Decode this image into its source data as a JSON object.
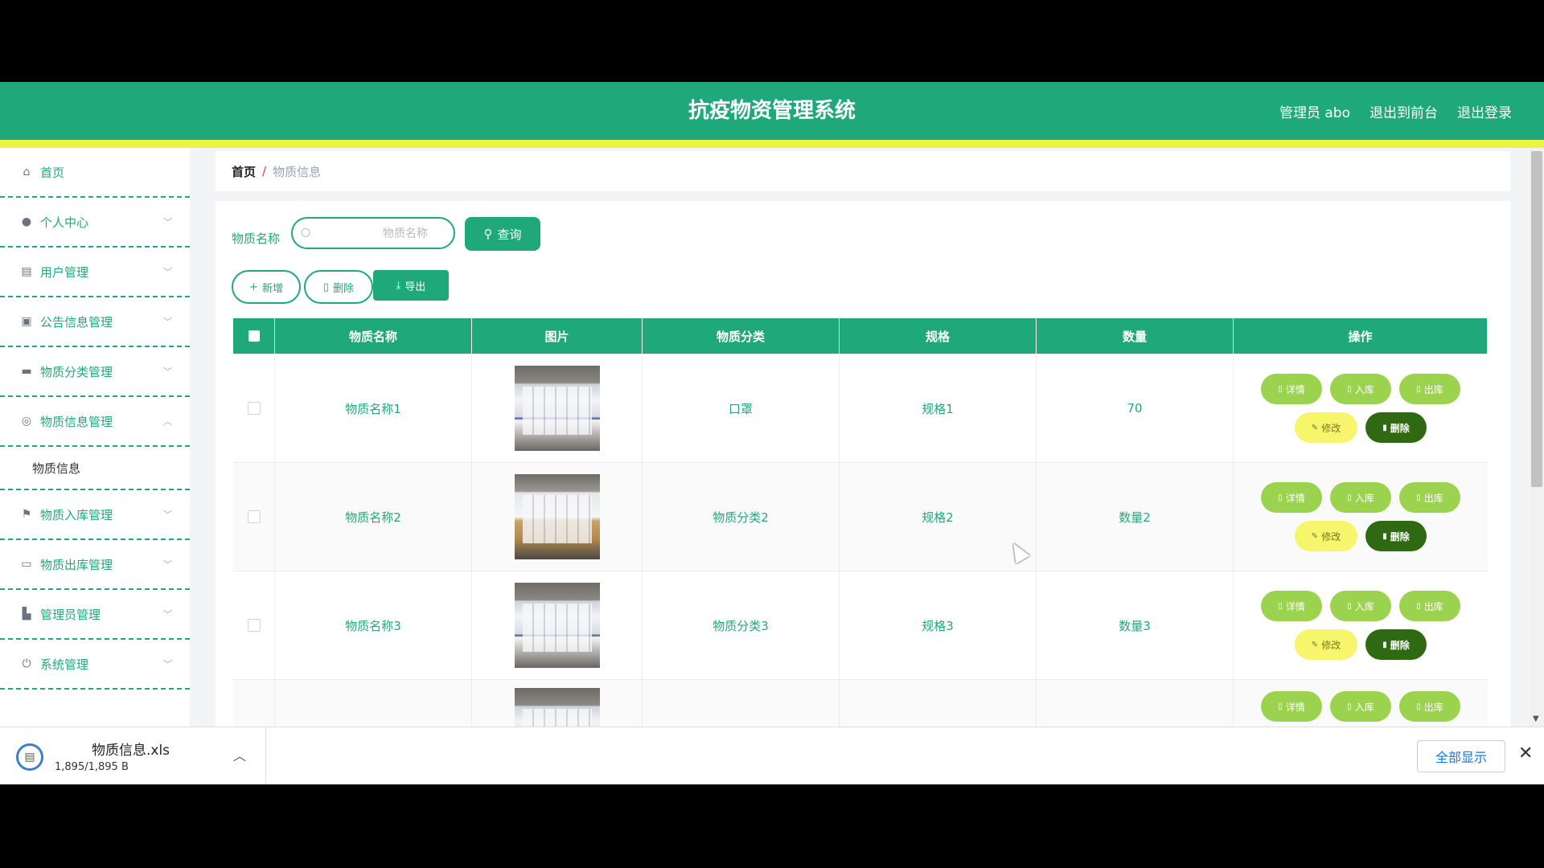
{
  "header": {
    "title": "抗疫物资管理系统",
    "admin_label": "管理员 abo",
    "back_front": "退出到前台",
    "logout": "退出登录"
  },
  "sidebar": {
    "items": [
      {
        "label": "首页",
        "icon": "home-icon"
      },
      {
        "label": "个人中心",
        "icon": "user-icon"
      },
      {
        "label": "用户管理",
        "icon": "chart-icon"
      },
      {
        "label": "公告信息管理",
        "icon": "clipboard-icon"
      },
      {
        "label": "物质分类管理",
        "icon": "briefcase-icon"
      },
      {
        "label": "物质信息管理",
        "icon": "globe-icon"
      },
      {
        "label": "物质入库管理",
        "icon": "flag-icon"
      },
      {
        "label": "物质出库管理",
        "icon": "message-icon"
      },
      {
        "label": "管理员管理",
        "icon": "admin-icon"
      },
      {
        "label": "系统管理",
        "icon": "power-icon"
      }
    ],
    "sub_item": "物质信息"
  },
  "breadcrumb": {
    "home": "首页",
    "sep": "/",
    "current": "物质信息"
  },
  "search": {
    "label": "物质名称",
    "placeholder": "物质名称",
    "button": "查询"
  },
  "toolbar": {
    "add": "新增",
    "delete": "删除",
    "export": "导出"
  },
  "table": {
    "headers": [
      "物质名称",
      "图片",
      "物质分类",
      "规格",
      "数量",
      "操作"
    ],
    "rows": [
      {
        "name": "物质名称1",
        "category": "口罩",
        "spec": "规格1",
        "qty": "70"
      },
      {
        "name": "物质名称2",
        "category": "物质分类2",
        "spec": "规格2",
        "qty": "数量2"
      },
      {
        "name": "物质名称3",
        "category": "物质分类3",
        "spec": "规格3",
        "qty": "数量3"
      }
    ],
    "ops": {
      "detail": "详情",
      "in": "入库",
      "out": "出库",
      "edit": "修改",
      "del": "删除"
    }
  },
  "download": {
    "file_name": "物质信息.xls",
    "size": "1,895/1,895 B",
    "show_all": "全部显示"
  },
  "colors": {
    "primary": "#1fa97b",
    "accent_strip": "#eef244",
    "op_green": "#9bd34f",
    "op_yellow": "#f6f56b",
    "op_dark": "#2f6a12"
  }
}
